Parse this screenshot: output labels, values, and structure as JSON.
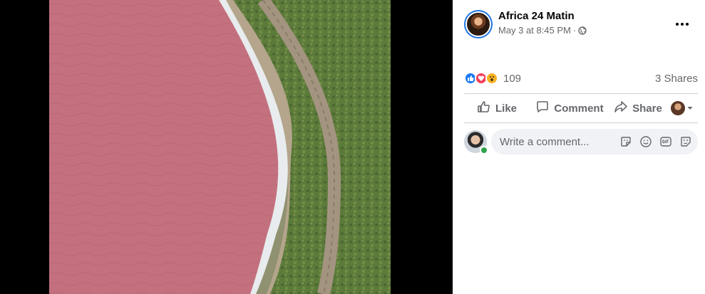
{
  "post": {
    "page_name": "Africa 24 Matin",
    "date": "May 3 at 8:45 PM",
    "separator": "·",
    "privacy_icon": "globe-icon",
    "more_icon": "more-horizontal-icon"
  },
  "photo": {
    "subject": "pink-lake-aerial",
    "colors": {
      "water": "#c4717f",
      "shore": "#e8ecee",
      "road": "#a39480",
      "vegetation": "#5c7a3a"
    }
  },
  "reactions": {
    "icons": [
      "like-reaction-icon",
      "love-reaction-icon",
      "wow-reaction-icon"
    ],
    "count": "109",
    "shares": "3 Shares"
  },
  "actions": {
    "like": "Like",
    "comment": "Comment",
    "share": "Share"
  },
  "comment_input": {
    "placeholder": "Write a comment...",
    "tools": [
      "sticker-icon",
      "emoji-icon",
      "gif-icon",
      "avatar-sticker-icon"
    ]
  },
  "colors": {
    "accent": "#1877f2",
    "love": "#f33e58",
    "wow": "#f7b125",
    "online": "#31a24c",
    "secondary_text": "#65676b"
  }
}
